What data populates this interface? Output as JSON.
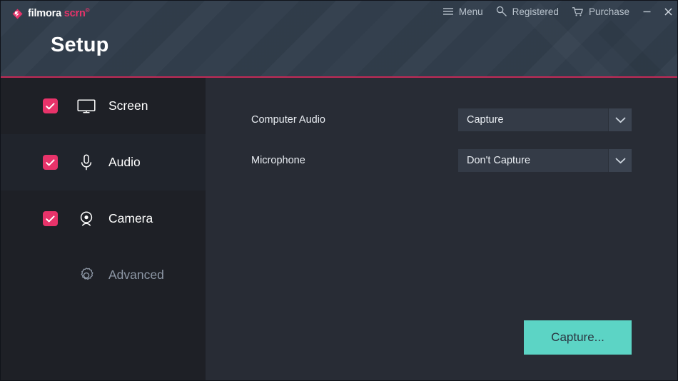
{
  "window": {
    "logo": {
      "word1": "filmora",
      "word2": "scrn",
      "trademark": "®"
    },
    "titlebar": {
      "menu_label": "Menu",
      "registered_label": "Registered",
      "purchase_label": "Purchase",
      "minimize_label": "─",
      "close_label": "✕"
    },
    "page_title": "Setup"
  },
  "sidebar": {
    "items": [
      {
        "label": "Screen",
        "icon": "monitor-icon",
        "checked": true,
        "enabled": true
      },
      {
        "label": "Audio",
        "icon": "microphone-icon",
        "checked": true,
        "enabled": true
      },
      {
        "label": "Camera",
        "icon": "webcam-icon",
        "checked": true,
        "enabled": true
      },
      {
        "label": "Advanced",
        "icon": "gear-icon",
        "checked": false,
        "enabled": false
      }
    ]
  },
  "main": {
    "rows": [
      {
        "label": "Computer Audio",
        "value": "Capture",
        "options": [
          "Capture",
          "Don't Capture"
        ]
      },
      {
        "label": "Microphone",
        "value": "Don't Capture",
        "options": [
          "Capture",
          "Don't Capture"
        ]
      }
    ],
    "capture_button": "Capture..."
  },
  "colors": {
    "accent_pink": "#e8336a",
    "accent_line": "#c22a57",
    "capture_teal": "#5cd4c5",
    "header_bg": "#323e4c",
    "sidebar_bg": "#1e2026",
    "content_bg": "#282c35"
  }
}
